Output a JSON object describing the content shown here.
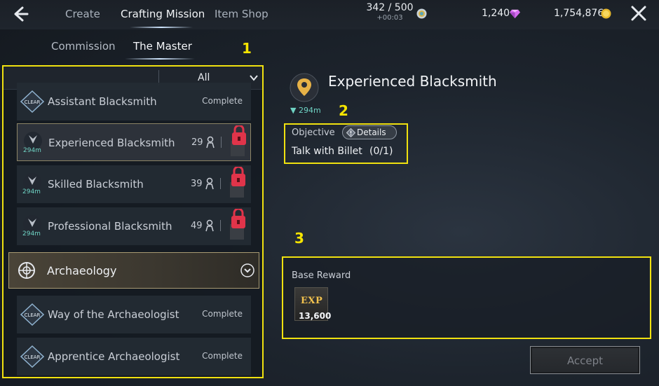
{
  "nav": {
    "tabs": [
      {
        "label": "Create"
      },
      {
        "label": "Crafting Mission"
      },
      {
        "label": "Item Shop"
      }
    ],
    "active_tab": "Crafting Mission"
  },
  "stats": {
    "stamina": "342 / 500",
    "stamina_timer": "+00:03",
    "gems": "1,240",
    "gold": "1,754,876"
  },
  "subtabs": [
    {
      "label": "Commission"
    },
    {
      "label": "The Master"
    }
  ],
  "callouts": [
    "1",
    "2",
    "3"
  ],
  "filter": {
    "label": "All"
  },
  "missions": [
    {
      "title": "Assistant Blacksmith",
      "status": "Complete",
      "badge": "CLEAR"
    },
    {
      "title": "Experienced Blacksmith",
      "level": "29",
      "distance": "294m",
      "locked": true,
      "selected": true
    },
    {
      "title": "Skilled Blacksmith",
      "level": "39",
      "distance": "294m",
      "locked": true
    },
    {
      "title": "Professional Blacksmith",
      "level": "49",
      "distance": "294m",
      "locked": true
    }
  ],
  "category": {
    "label": "Archaeology"
  },
  "category_missions": [
    {
      "title": "Way of the Archaeologist",
      "status": "Complete",
      "badge": "CLEAR"
    },
    {
      "title": "Apprentice Archaeologist",
      "status": "Complete",
      "badge": "CLEAR"
    }
  ],
  "detail": {
    "title": "Experienced Blacksmith",
    "distance": "294m",
    "objective_label": "Objective",
    "details_button": "Details",
    "objective_text": "Talk with Billet",
    "objective_progress": "(0/1)"
  },
  "reward": {
    "label": "Base Reward",
    "item_tag": "EXP",
    "amount": "13,600"
  },
  "accept_label": "Accept",
  "colors": {
    "highlight": "#f0e10f",
    "distance": "#6fd3c4",
    "lock": "#e0344a",
    "exp": "#f2c24e"
  }
}
